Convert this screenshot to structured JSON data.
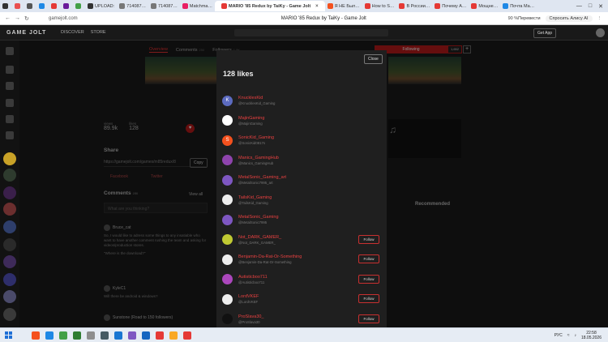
{
  "browser": {
    "tabs": [
      {
        "label": "",
        "color": "#333"
      },
      {
        "label": "",
        "color": "#e94f4f"
      },
      {
        "label": "",
        "color": "#555"
      },
      {
        "label": "",
        "color": "#1e88e5"
      },
      {
        "label": "",
        "color": "#e53935"
      },
      {
        "label": "",
        "color": "#6a1b9a"
      },
      {
        "label": "",
        "color": "#43a047"
      },
      {
        "label": "UPLOAD:",
        "color": "#333"
      },
      {
        "label": "714087…",
        "color": "#777"
      },
      {
        "label": "714087…",
        "color": "#777"
      },
      {
        "label": "Matchma…",
        "color": "#e91e63"
      },
      {
        "label": "MARIO '85 Redux by TaiKy - Game Jolt",
        "color": "#e53935",
        "active": true
      },
      {
        "label": "Я НЕ Был…",
        "color": "#f4511e"
      },
      {
        "label": "How to S…",
        "color": "#e53935"
      },
      {
        "label": "В России…",
        "color": "#e53935"
      },
      {
        "label": "Почему А…",
        "color": "#e53935"
      },
      {
        "label": "Мощне…",
        "color": "#e53935"
      },
      {
        "label": "Почта Ma…",
        "color": "#1e88e5"
      }
    ],
    "url": "gamejolt.com",
    "page_title": "MARIO '85 Redux by TaiKy - Game Jolt",
    "zoom": "90 %",
    "translate": "Перевести",
    "alice": "Спросить Алису AI"
  },
  "site": {
    "logo": "GAME JOLT",
    "nav": [
      "DISCOVER",
      "STORE"
    ],
    "get_app": "Get App"
  },
  "game_page": {
    "tabs": [
      {
        "label": "Overview",
        "count": "",
        "active": true
      },
      {
        "label": "Comments",
        "count": "250",
        "active": false
      },
      {
        "label": "Followers",
        "count": "1.5K",
        "active": false
      }
    ],
    "following_label": "Following",
    "follow_count": "1,652",
    "stats": [
      {
        "label": "views",
        "value": "89.9k"
      },
      {
        "label": "likes",
        "value": "128"
      }
    ],
    "share_title": "Share",
    "share_url": "https://gamejolt.com/games/m85redux/8",
    "copy_label": "Copy",
    "share_links": [
      "Facebook",
      "Twitter"
    ],
    "comments_title": "Comments",
    "comments_count": "250",
    "view_all": "View all",
    "comment_placeholder": "What are you thinking?",
    "comments": [
      {
        "author": "Bruce_cat",
        "text": "So, I would like to adress some things to any insatiable who want to have another comment rushing the team and asking for videos/production stores.",
        "quote": "\"Where is the download?\""
      },
      {
        "author": "KyleC1",
        "text": "Will there be android & windows?"
      },
      {
        "author": "Sunstone (Road to 150 followers)",
        "text": ""
      }
    ],
    "recommended": "Recommended"
  },
  "modal": {
    "close_label": "Close",
    "title": "128 likes",
    "follow_label": "Follow",
    "users": [
      {
        "name": "KnucklesKid",
        "handle": "@KnucklesKid_Gaming",
        "avatar_color": "#5c6bc0",
        "initial": "K",
        "show_follow": false
      },
      {
        "name": "MajinGaming",
        "handle": "@MajinGaming",
        "avatar_color": "#ffffff",
        "initial": "",
        "show_follow": false
      },
      {
        "name": "SonicKid_Gaming",
        "handle": "@SonicKid0817s",
        "avatar_color": "#f4511e",
        "initial": "S",
        "show_follow": false
      },
      {
        "name": "Manics_GamingHub",
        "handle": "@Manics_GamingHub",
        "avatar_color": "#8e44ad",
        "initial": "",
        "show_follow": false
      },
      {
        "name": "MetalSonic_Gaming_art",
        "handle": "@MetalSonic7995_art",
        "avatar_color": "#7e57c2",
        "initial": "",
        "show_follow": false
      },
      {
        "name": "TailsKid_Gaming",
        "handle": "@TailsKid_Gaming",
        "avatar_color": "#eeeeee",
        "initial": "",
        "show_follow": false
      },
      {
        "name": "MetalSonic_Gaming",
        "handle": "@MetalSonic7995",
        "avatar_color": "#7e57c2",
        "initial": "",
        "show_follow": false
      },
      {
        "name": "Not_DARK_GAMER_",
        "handle": "@Not_DARK_GAMER_",
        "avatar_color": "#c0ca33",
        "initial": "",
        "show_follow": true
      },
      {
        "name": "Benjamin-Da-Rat-Or-Something",
        "handle": "@Benjamin-Da-Rat-Or-Something",
        "avatar_color": "#eeeeee",
        "initial": "",
        "show_follow": true
      },
      {
        "name": "Autisticboo711",
        "handle": "@Autisticboo711",
        "avatar_color": "#ab47bc",
        "initial": "",
        "show_follow": true
      },
      {
        "name": "LordVKEF",
        "handle": "@LordVKEF",
        "avatar_color": "#eeeeee",
        "initial": "",
        "show_follow": true
      },
      {
        "name": "ProSlava30_",
        "handle": "@ProSlava30",
        "avatar_color": "#111111",
        "initial": "",
        "show_follow": true
      }
    ]
  },
  "taskbar": {
    "icons": [
      "#e6ecf4",
      "#f4511e",
      "#1e88e5",
      "#43a047",
      "#2e7d32",
      "#8e8e8e",
      "#455a64",
      "#1976d2",
      "#7e57c2",
      "#1565c0",
      "#e53935",
      "#f9a825",
      "#e53935"
    ],
    "language": "РУС",
    "time": "22:58",
    "date": "18.05.2026"
  }
}
